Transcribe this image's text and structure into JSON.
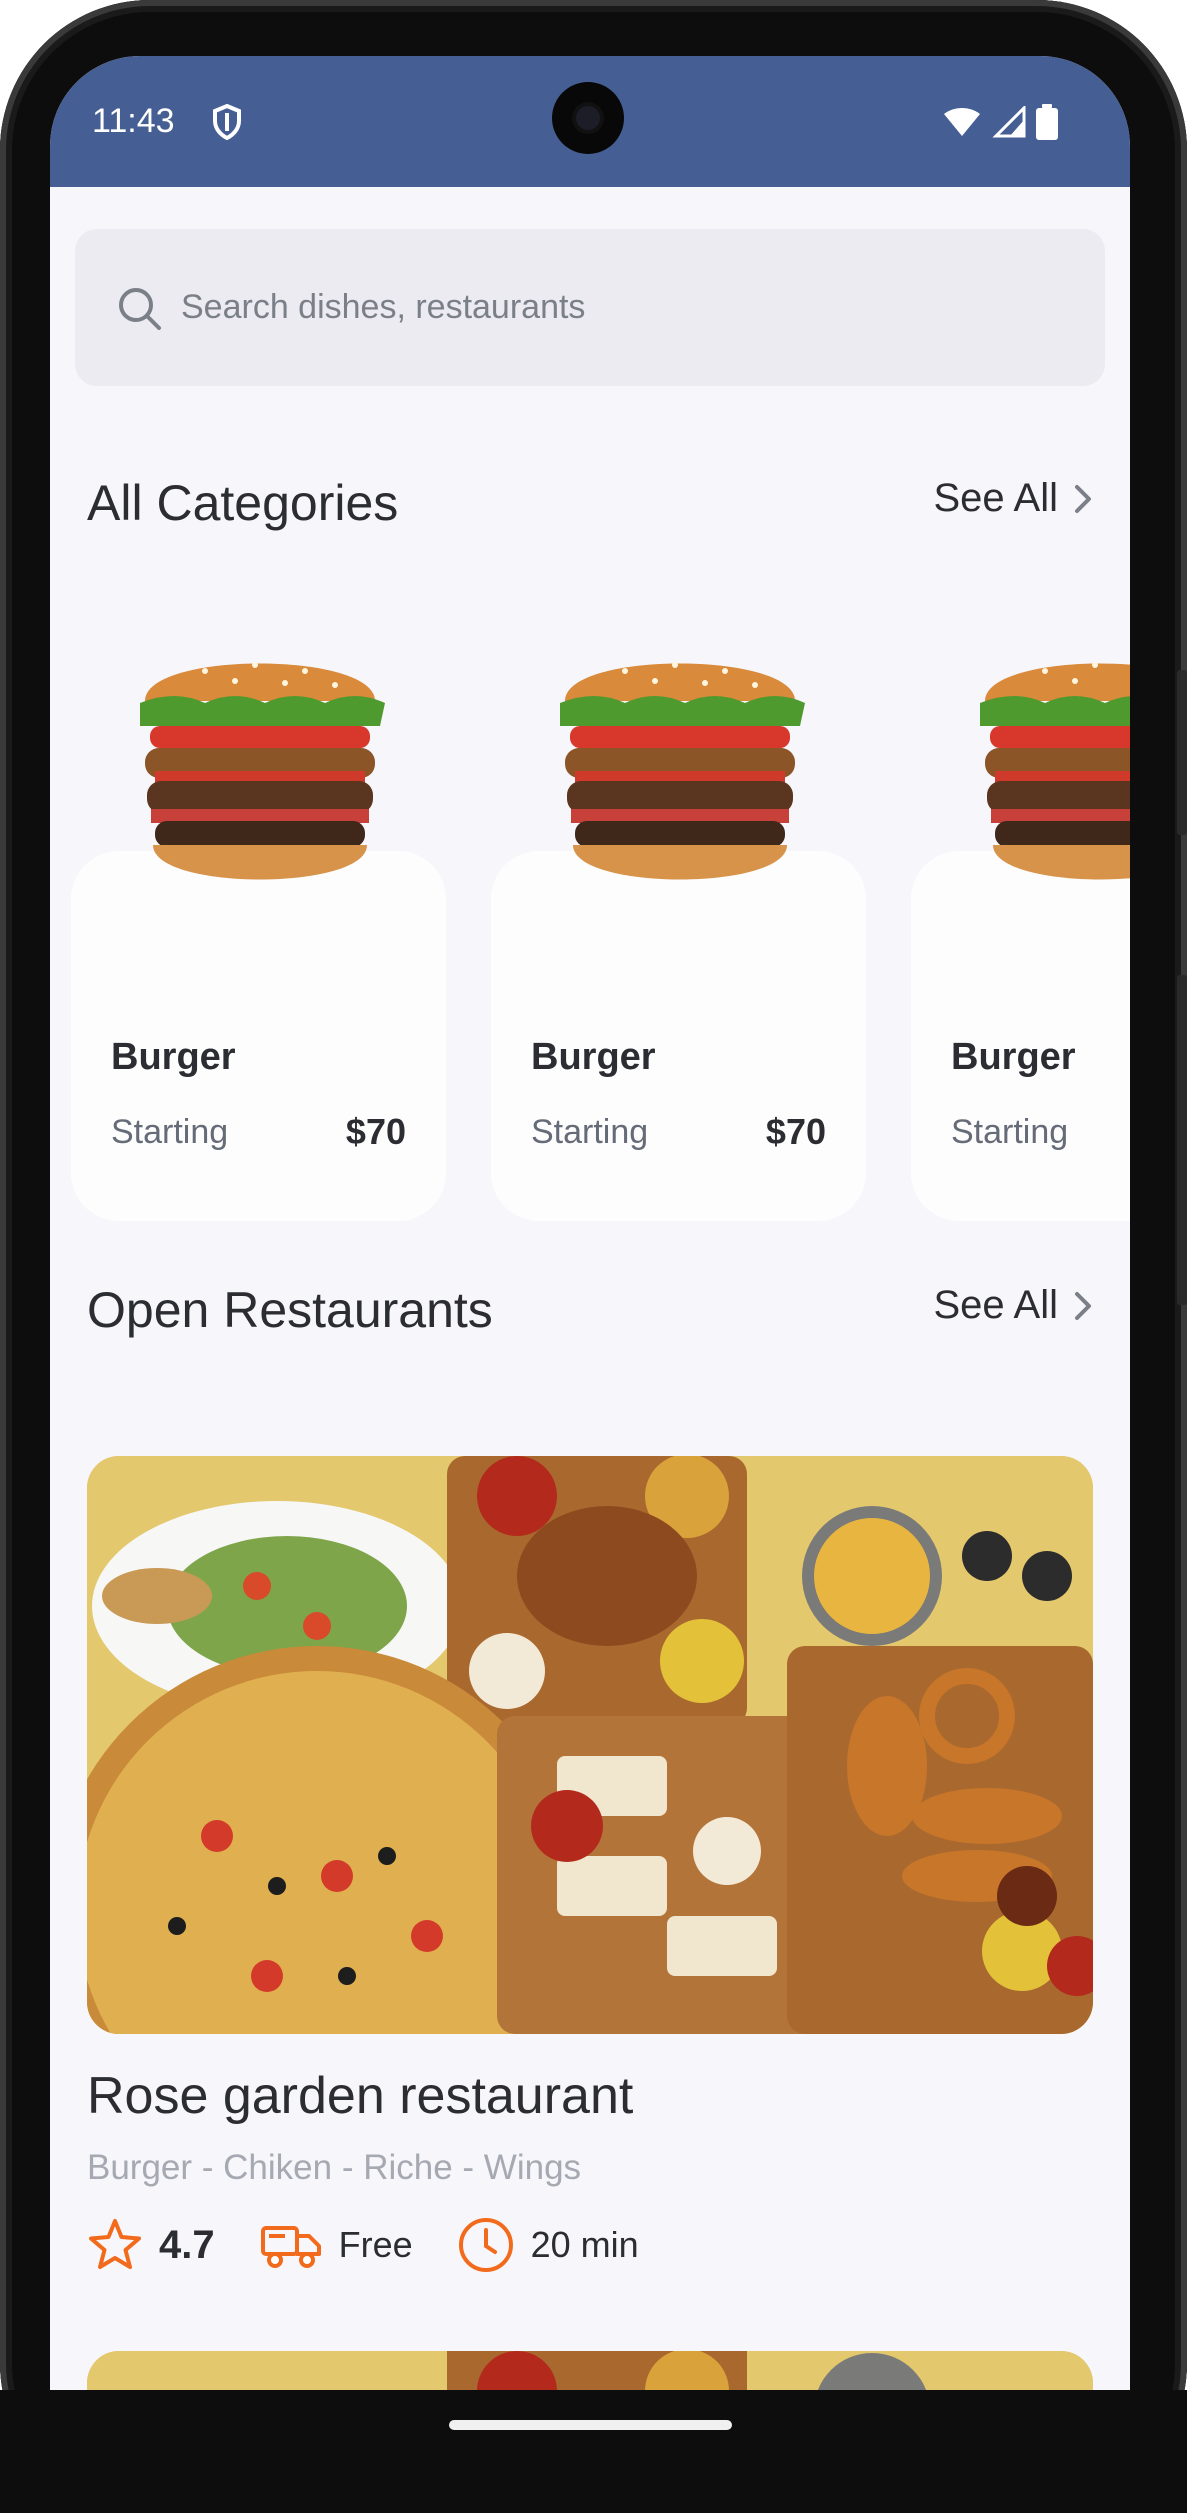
{
  "status_bar": {
    "time": "11:43"
  },
  "search": {
    "placeholder": "Search dishes, restaurants"
  },
  "categories_section": {
    "title": "All Categories",
    "see_all": "See All",
    "items": [
      {
        "name": "Burger",
        "starting_label": "Starting",
        "price": "$70"
      },
      {
        "name": "Burger",
        "starting_label": "Starting",
        "price": "$70"
      },
      {
        "name": "Burger",
        "starting_label": "Starting",
        "price": ""
      }
    ]
  },
  "restaurants_section": {
    "title": "Open Restaurants",
    "see_all": "See All",
    "restaurants": [
      {
        "name": "Rose garden restaurant",
        "tags": "Burger - Chiken - Riche - Wings",
        "rating": "4.7",
        "delivery": "Free",
        "time": "20 min"
      }
    ]
  },
  "colors": {
    "status_bar": "#455e93",
    "accent": "#f26b1d",
    "background": "#f7f6fb"
  },
  "icons": [
    "search-icon",
    "shield-icon",
    "wifi-icon",
    "signal-icon",
    "battery-icon",
    "chevron-right-icon",
    "star-icon",
    "truck-icon",
    "clock-icon"
  ]
}
